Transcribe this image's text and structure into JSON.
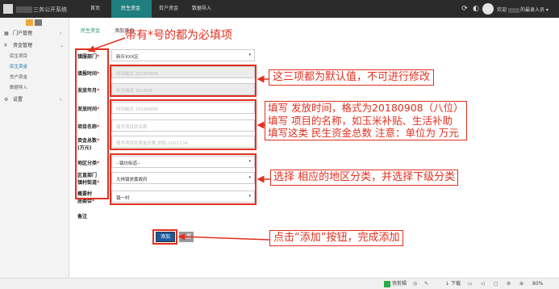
{
  "app": {
    "title": "三务公开系统"
  },
  "topnav": [
    "首页",
    "民生资金",
    "贫户资金",
    "数据导入"
  ],
  "header": {
    "welcome": "欢迎",
    "user_suffix": "的最录入员 ▾"
  },
  "sidebar": {
    "items": [
      {
        "label": "门户管理",
        "icon": "grid-icon"
      },
      {
        "label": "资金管理",
        "icon": "money-icon"
      },
      {
        "label": "设置",
        "icon": "gear-icon"
      }
    ],
    "sub_items": [
      "民生项目",
      "民生资金",
      "贫户资金",
      "数据导入"
    ]
  },
  "tabs": [
    "民生资金",
    "添加资金"
  ],
  "form": {
    "town": {
      "label": "镇服部门",
      "value": "新乐XXX区"
    },
    "release_time": {
      "label": "填报时间",
      "placeholder": "时间格式 20180908"
    },
    "release_month": {
      "label": "发放年月",
      "placeholder": "年月格式 201809"
    },
    "grant_time": {
      "label": "发放时间",
      "placeholder": "时间格式 20180908"
    },
    "project_name": {
      "label": "项目名称",
      "placeholder": "填写项目的名称"
    },
    "total_amount": {
      "label": "资金总数(万元)",
      "label_line1": "资金总数",
      "label_line2": "(万元)",
      "placeholder": "填写项目的资金总数,例如:1001234"
    },
    "area_category": {
      "label": "地区分类",
      "value": "--镇坊街道--"
    },
    "district_dept": {
      "label": "区直部门镇村街道",
      "label_line1": "区直部门",
      "label_line2": "镇村街道",
      "value": "大林镇党委政府"
    },
    "village": {
      "label": "村居委会",
      "label_line1": "概要村",
      "label_line2": "居委会",
      "value": "镇一村"
    },
    "remark": {
      "label": "备注"
    },
    "add_button": "添加",
    "reset_button": "重置"
  },
  "annotations": {
    "required": "带有*号的都为必填项",
    "defaults": "这三项都为默认值，不可进行修改",
    "fill_line1": "填写 发放时间，格式为20180908（八位）",
    "fill_line2": "填写 项目的名称，如玉米补贴、生活补助",
    "fill_line3": "填写这类 民生资金总数 注意：单位为 万元",
    "select": "选择 相应的地区分类，并选择下级分类",
    "click": "点击“添加”按钮，完成添加"
  },
  "statusbar": {
    "quick": "快剪辑",
    "download": "下载",
    "zoom": "80%"
  }
}
